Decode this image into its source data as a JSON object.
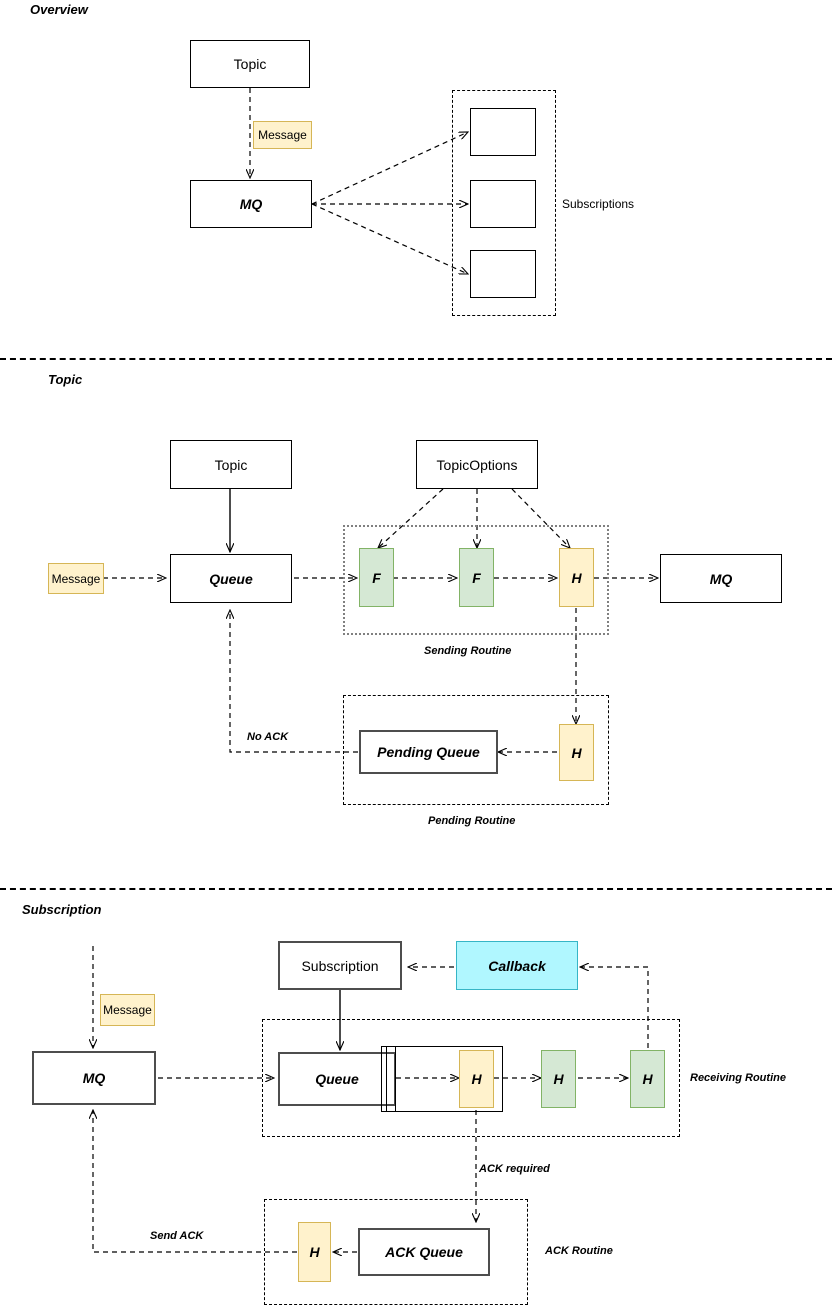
{
  "sections": [
    {
      "title": "Overview"
    },
    {
      "title": "Topic"
    },
    {
      "title": "Subscription"
    }
  ],
  "overview": {
    "topic_box": "Topic",
    "message_label": "Message",
    "mq_box": "MQ",
    "subscriptions_label": "Subscriptions",
    "subscription_boxes": [
      "",
      "",
      ""
    ]
  },
  "topic": {
    "topic_box": "Topic",
    "topic_options_box": "TopicOptions",
    "message_label": "Message",
    "queue_box": "Queue",
    "filter_1": "F",
    "filter_2": "F",
    "handler_send": "H",
    "mq_box": "MQ",
    "sending_routine_label": "Sending Routine",
    "pending_queue_box": "Pending Queue",
    "handler_pending": "H",
    "pending_routine_label": "Pending Routine",
    "no_ack_label": "No ACK"
  },
  "subscription": {
    "message_label": "Message",
    "mq_box": "MQ",
    "subscription_box": "Subscription",
    "callback_box": "Callback",
    "queue_box": "Queue",
    "handler_1": "H",
    "handler_2": "H",
    "handler_3": "H",
    "receiving_routine_label": "Receiving Routine",
    "ack_required_label": "ACK required",
    "ack_queue_box": "ACK Queue",
    "handler_ack": "H",
    "ack_routine_label": "ACK Routine",
    "send_ack_label": "Send ACK"
  },
  "colors": {
    "green_fill": "#d5e8d4",
    "green_stroke": "#82b366",
    "yellow_fill": "#fff2cc",
    "yellow_stroke": "#d6b656",
    "cyan_fill": "#b0f7ff",
    "cyan_stroke": "#36b5c6",
    "box_stroke": "#000000",
    "group_stroke": "#666666",
    "background": "#ffffff"
  }
}
